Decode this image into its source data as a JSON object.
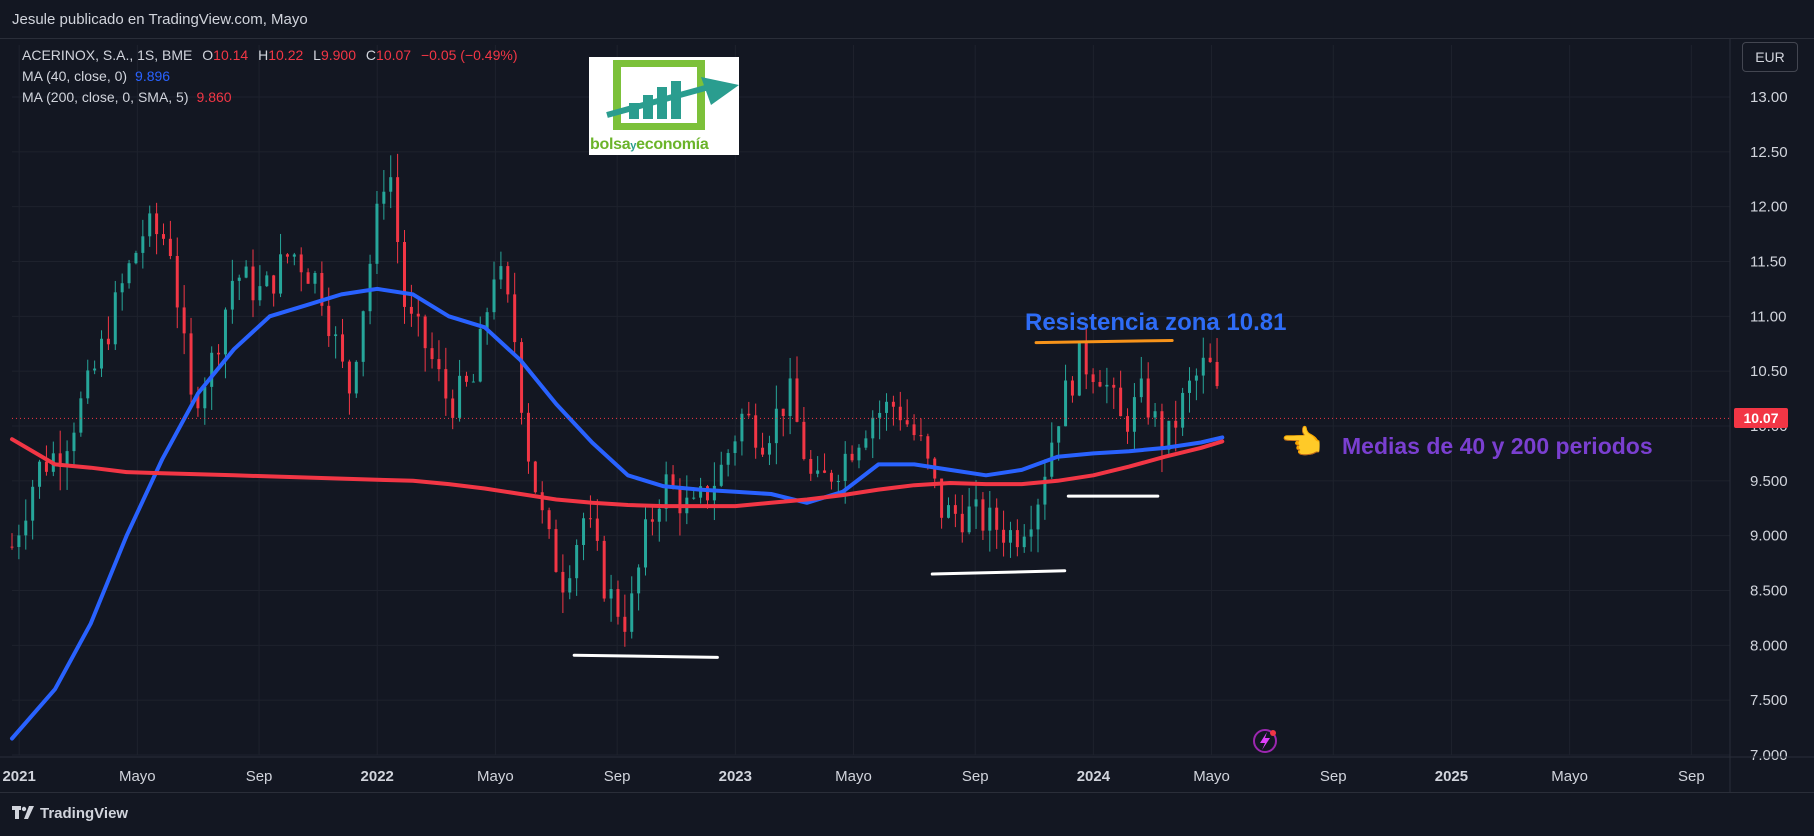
{
  "header": {
    "author_line": "Jesule publicado en TradingView.com, Mayo"
  },
  "legend": {
    "symbol": "ACERINOX, S.A., 1S, BME",
    "o_label": "O",
    "o_value": "10.14",
    "h_label": "H",
    "h_value": "10.22",
    "l_label": "L",
    "l_value": "9.900",
    "c_label": "C",
    "c_value": "10.07",
    "change": "−0.05 (−0.49%)",
    "ma1_label": "MA (40, close, 0)",
    "ma1_value": "9.896",
    "ma2_label": "MA (200, close, 0, SMA, 5)",
    "ma2_value": "9.860"
  },
  "currency": "EUR",
  "last_price": "10.07",
  "logo": {
    "word1": "bolsa",
    "word2": "y",
    "word3": "economía"
  },
  "annotations": {
    "resistance": "Resistencia zona 10.81",
    "averages": "Medias de 40 y 200 periodos",
    "hand_icon": "backhand-index-pointing-left-icon"
  },
  "footer": {
    "brand": "TradingView"
  },
  "colors": {
    "background": "#131722",
    "up": "#26a69a",
    "down": "#f23645",
    "ma40": "#2962ff",
    "ma200": "#f23645",
    "resistance_line": "#f7931a",
    "support_lines": "#ffffff",
    "grid": "#1e222d"
  },
  "chart_data": {
    "type": "candlestick",
    "title": "",
    "xlabel": "",
    "ylabel": "",
    "ylim": [
      7.0,
      13.2
    ],
    "yticks": [
      "13.00",
      "12.50",
      "12.00",
      "11.50",
      "11.00",
      "10.50",
      "10.00",
      "9.500",
      "9.000",
      "8.500",
      "8.000",
      "7.500",
      "7.000"
    ],
    "xticks": [
      "2021",
      "Mayo",
      "Sep",
      "2022",
      "Mayo",
      "Sep",
      "2023",
      "Mayo",
      "Sep",
      "2024",
      "Mayo",
      "Sep",
      "2025",
      "Mayo",
      "Sep"
    ],
    "xtick_bold": [
      true,
      false,
      false,
      true,
      false,
      false,
      true,
      false,
      false,
      true,
      false,
      false,
      true,
      false,
      false
    ],
    "x_range_years": [
      2020.98,
      2025.75
    ],
    "grid": true,
    "close_path": [
      [
        2020.98,
        8.9
      ],
      [
        2021.05,
        9.6
      ],
      [
        2021.12,
        9.8
      ],
      [
        2021.2,
        10.4
      ],
      [
        2021.28,
        11.2
      ],
      [
        2021.35,
        11.8
      ],
      [
        2021.42,
        11.7
      ],
      [
        2021.48,
        10.2
      ],
      [
        2021.54,
        10.6
      ],
      [
        2021.6,
        11.4
      ],
      [
        2021.68,
        11.2
      ],
      [
        2021.76,
        11.6
      ],
      [
        2021.84,
        11.3
      ],
      [
        2021.92,
        10.3
      ],
      [
        2021.98,
        11.5
      ],
      [
        2022.03,
        12.5
      ],
      [
        2022.08,
        11.0
      ],
      [
        2022.14,
        10.7
      ],
      [
        2022.2,
        10.2
      ],
      [
        2022.27,
        10.4
      ],
      [
        2022.33,
        11.5
      ],
      [
        2022.38,
        10.9
      ],
      [
        2022.42,
        9.8
      ],
      [
        2022.47,
        9.0
      ],
      [
        2022.52,
        8.6
      ],
      [
        2022.58,
        9.2
      ],
      [
        2022.64,
        8.5
      ],
      [
        2022.7,
        8.2
      ],
      [
        2022.75,
        9.0
      ],
      [
        2022.8,
        9.5
      ],
      [
        2022.88,
        9.2
      ],
      [
        2022.96,
        9.6
      ],
      [
        2023.02,
        10.1
      ],
      [
        2023.08,
        9.9
      ],
      [
        2023.15,
        10.3
      ],
      [
        2023.22,
        9.4
      ],
      [
        2023.3,
        9.7
      ],
      [
        2023.38,
        10.1
      ],
      [
        2023.45,
        10.2
      ],
      [
        2023.52,
        9.8
      ],
      [
        2023.58,
        9.2
      ],
      [
        2023.65,
        9.2
      ],
      [
        2023.72,
        9.1
      ],
      [
        2023.78,
        9.0
      ],
      [
        2023.84,
        9.3
      ],
      [
        2023.9,
        10.1
      ],
      [
        2023.96,
        10.6
      ],
      [
        2024.02,
        10.5
      ],
      [
        2024.08,
        10.0
      ],
      [
        2024.14,
        10.3
      ],
      [
        2024.2,
        9.8
      ],
      [
        2024.26,
        10.3
      ],
      [
        2024.32,
        10.6
      ],
      [
        2024.36,
        10.07
      ]
    ],
    "series": [
      {
        "name": "MA (40, close, 0)",
        "values": [
          [
            2020.98,
            7.15
          ],
          [
            2021.1,
            7.6
          ],
          [
            2021.2,
            8.2
          ],
          [
            2021.3,
            9.0
          ],
          [
            2021.4,
            9.7
          ],
          [
            2021.5,
            10.3
          ],
          [
            2021.6,
            10.7
          ],
          [
            2021.7,
            11.0
          ],
          [
            2021.8,
            11.1
          ],
          [
            2021.9,
            11.2
          ],
          [
            2022.0,
            11.25
          ],
          [
            2022.1,
            11.2
          ],
          [
            2022.2,
            11.0
          ],
          [
            2022.3,
            10.9
          ],
          [
            2022.4,
            10.6
          ],
          [
            2022.5,
            10.2
          ],
          [
            2022.6,
            9.85
          ],
          [
            2022.7,
            9.55
          ],
          [
            2022.8,
            9.45
          ],
          [
            2022.9,
            9.42
          ],
          [
            2023.0,
            9.4
          ],
          [
            2023.1,
            9.38
          ],
          [
            2023.2,
            9.3
          ],
          [
            2023.3,
            9.4
          ],
          [
            2023.4,
            9.65
          ],
          [
            2023.5,
            9.65
          ],
          [
            2023.6,
            9.6
          ],
          [
            2023.7,
            9.55
          ],
          [
            2023.8,
            9.6
          ],
          [
            2023.9,
            9.72
          ],
          [
            2024.0,
            9.75
          ],
          [
            2024.1,
            9.77
          ],
          [
            2024.2,
            9.8
          ],
          [
            2024.3,
            9.85
          ],
          [
            2024.36,
            9.896
          ]
        ]
      },
      {
        "name": "MA (200, close, 0, SMA, 5)",
        "values": [
          [
            2020.98,
            9.88
          ],
          [
            2021.1,
            9.65
          ],
          [
            2021.2,
            9.62
          ],
          [
            2021.3,
            9.58
          ],
          [
            2021.4,
            9.57
          ],
          [
            2021.5,
            9.56
          ],
          [
            2021.6,
            9.55
          ],
          [
            2021.7,
            9.54
          ],
          [
            2021.8,
            9.53
          ],
          [
            2021.9,
            9.52
          ],
          [
            2022.0,
            9.51
          ],
          [
            2022.1,
            9.5
          ],
          [
            2022.2,
            9.47
          ],
          [
            2022.3,
            9.43
          ],
          [
            2022.4,
            9.38
          ],
          [
            2022.5,
            9.33
          ],
          [
            2022.6,
            9.3
          ],
          [
            2022.7,
            9.28
          ],
          [
            2022.8,
            9.27
          ],
          [
            2022.9,
            9.27
          ],
          [
            2023.0,
            9.27
          ],
          [
            2023.1,
            9.3
          ],
          [
            2023.2,
            9.33
          ],
          [
            2023.3,
            9.37
          ],
          [
            2023.4,
            9.42
          ],
          [
            2023.5,
            9.46
          ],
          [
            2023.6,
            9.48
          ],
          [
            2023.7,
            9.47
          ],
          [
            2023.8,
            9.47
          ],
          [
            2023.9,
            9.5
          ],
          [
            2024.0,
            9.55
          ],
          [
            2024.1,
            9.63
          ],
          [
            2024.2,
            9.72
          ],
          [
            2024.3,
            9.8
          ],
          [
            2024.36,
            9.86
          ]
        ]
      }
    ],
    "resistance_level": 10.81,
    "support_segments": [
      [
        [
          2022.55,
          7.91
        ],
        [
          2022.95,
          7.89
        ]
      ],
      [
        [
          2023.55,
          8.65
        ],
        [
          2023.92,
          8.68
        ]
      ],
      [
        [
          2023.93,
          9.36
        ],
        [
          2024.18,
          9.36
        ]
      ]
    ],
    "resistance_segment": [
      [
        2023.84,
        10.76
      ],
      [
        2024.22,
        10.78
      ]
    ]
  }
}
